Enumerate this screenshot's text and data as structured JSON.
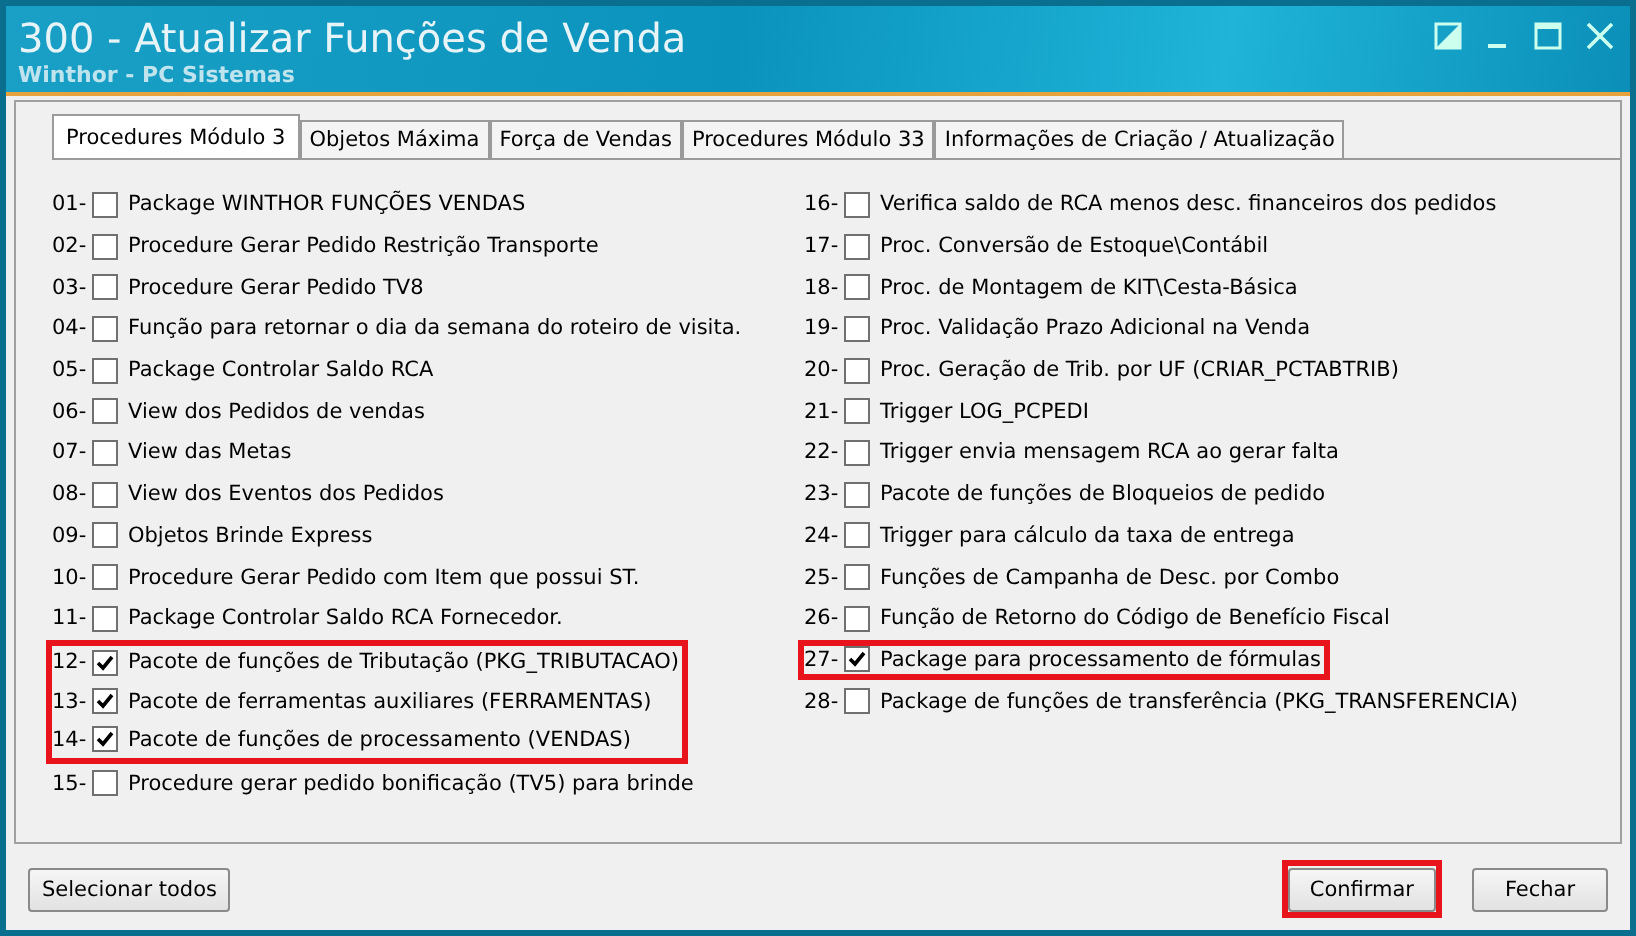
{
  "window": {
    "title": "300 - Atualizar Funções de Venda",
    "subtitle": "Winthor - PC Sistemas"
  },
  "tabs": [
    {
      "label": "Procedures Módulo 3",
      "selected": true
    },
    {
      "label": "Objetos Máxima",
      "selected": false
    },
    {
      "label": "Força de Vendas",
      "selected": false
    },
    {
      "label": "Procedures Módulo 33",
      "selected": false
    },
    {
      "label": "Informações de Criação / Atualização",
      "selected": false
    }
  ],
  "columns": [
    [
      {
        "number": "01-",
        "label": "Package WINTHOR FUNÇÕES VENDAS",
        "checked": false,
        "highlighted": false
      },
      {
        "number": "02-",
        "label": "Procedure Gerar Pedido Restrição Transporte",
        "checked": false,
        "highlighted": false
      },
      {
        "number": "03-",
        "label": "Procedure Gerar Pedido TV8",
        "checked": false,
        "highlighted": false
      },
      {
        "number": "04-",
        "label": "Função para retornar o dia da semana do roteiro de visita.",
        "checked": false,
        "highlighted": false
      },
      {
        "number": "05-",
        "label": "Package Controlar Saldo RCA",
        "checked": false,
        "highlighted": false
      },
      {
        "number": "06-",
        "label": "View dos Pedidos de vendas",
        "checked": false,
        "highlighted": false
      },
      {
        "number": "07-",
        "label": "View das Metas",
        "checked": false,
        "highlighted": false
      },
      {
        "number": "08-",
        "label": "View dos Eventos dos Pedidos",
        "checked": false,
        "highlighted": false
      },
      {
        "number": "09-",
        "label": "Objetos Brinde Express",
        "checked": false,
        "highlighted": false
      },
      {
        "number": "10-",
        "label": "Procedure Gerar Pedido com Item que possui ST.",
        "checked": false,
        "highlighted": false
      },
      {
        "number": "11-",
        "label": "Package Controlar Saldo RCA Fornecedor.",
        "checked": false,
        "highlighted": false
      },
      {
        "number": "12-",
        "label": "Pacote de funções de Tributação (PKG_TRIBUTACAO)",
        "checked": true,
        "highlighted": true
      },
      {
        "number": "13-",
        "label": "Pacote de ferramentas auxiliares (FERRAMENTAS)",
        "checked": true,
        "highlighted": true
      },
      {
        "number": "14-",
        "label": "Pacote de funções de processamento (VENDAS)",
        "checked": true,
        "highlighted": true
      },
      {
        "number": "15-",
        "label": "Procedure gerar pedido bonificação (TV5) para brinde",
        "checked": false,
        "highlighted": false
      }
    ],
    [
      {
        "number": "16-",
        "label": "Verifica saldo de RCA menos desc. financeiros dos pedidos",
        "checked": false,
        "highlighted": false
      },
      {
        "number": "17-",
        "label": "Proc. Conversão de Estoque\\Contábil",
        "checked": false,
        "highlighted": false
      },
      {
        "number": "18-",
        "label": "Proc. de Montagem de KIT\\Cesta-Básica",
        "checked": false,
        "highlighted": false
      },
      {
        "number": "19-",
        "label": "Proc. Validação Prazo Adicional na Venda",
        "checked": false,
        "highlighted": false
      },
      {
        "number": "20-",
        "label": "Proc. Geração de Trib. por UF (CRIAR_PCTABTRIB)",
        "checked": false,
        "highlighted": false
      },
      {
        "number": "21-",
        "label": "Trigger LOG_PCPEDI",
        "checked": false,
        "highlighted": false
      },
      {
        "number": "22-",
        "label": "Trigger envia mensagem RCA ao gerar falta",
        "checked": false,
        "highlighted": false
      },
      {
        "number": "23-",
        "label": "Pacote de funções de Bloqueios de pedido",
        "checked": false,
        "highlighted": false
      },
      {
        "number": "24-",
        "label": "Trigger para cálculo da taxa de entrega",
        "checked": false,
        "highlighted": false
      },
      {
        "number": "25-",
        "label": "Funções de Campanha de Desc. por Combo",
        "checked": false,
        "highlighted": false
      },
      {
        "number": "26-",
        "label": "Função de Retorno do Código de Benefício Fiscal",
        "checked": false,
        "highlighted": false
      },
      {
        "number": "27-",
        "label": "Package para processamento de fórmulas",
        "checked": true,
        "highlighted": true
      },
      {
        "number": "28-",
        "label": "Package de funções de transferência (PKG_TRANSFERENCIA)",
        "checked": false,
        "highlighted": false
      }
    ]
  ],
  "buttons": [
    {
      "label": "Selecionar todos",
      "highlighted": false
    },
    {
      "label": "Confirmar",
      "highlighted": true
    },
    {
      "label": "Fechar",
      "highlighted": false
    }
  ]
}
